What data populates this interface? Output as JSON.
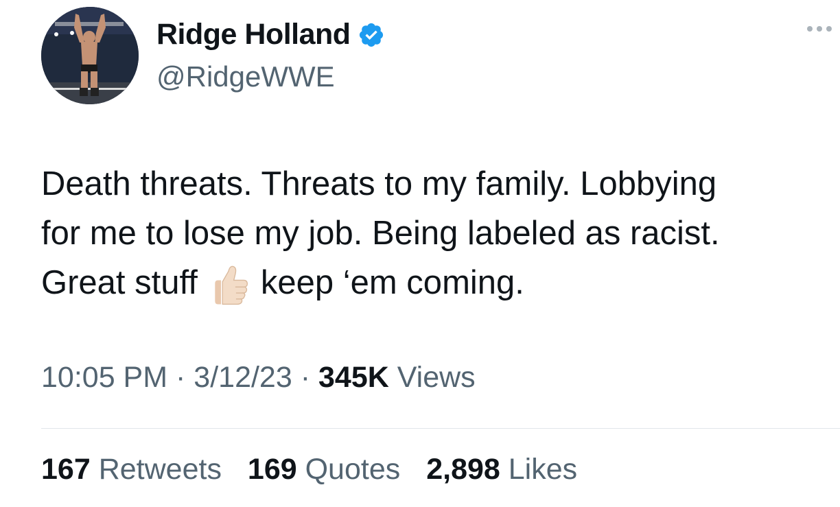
{
  "author": {
    "display_name": "Ridge Holland",
    "handle": "@RidgeWWE",
    "verified": true,
    "avatar_icon": "wrestler-avatar-icon"
  },
  "tweet": {
    "text_part1": "Death threats. Threats to my family. Lobbying\nfor me to lose my job. Being labeled as racist.\nGreat stuff",
    "emoji": "thumbs-up-light-skin-tone",
    "text_part2": "keep ‘em coming."
  },
  "meta": {
    "time": "10:05 PM",
    "separator": "·",
    "date": "3/12/23",
    "views_count": "345K",
    "views_label": "Views"
  },
  "stats": {
    "retweets_count": "167",
    "retweets_label": "Retweets",
    "quotes_count": "169",
    "quotes_label": "Quotes",
    "likes_count": "2,898",
    "likes_label": "Likes"
  },
  "colors": {
    "verified_blue": "#1d9bf0",
    "secondary_text": "#536471",
    "primary_text": "#0f1419"
  }
}
